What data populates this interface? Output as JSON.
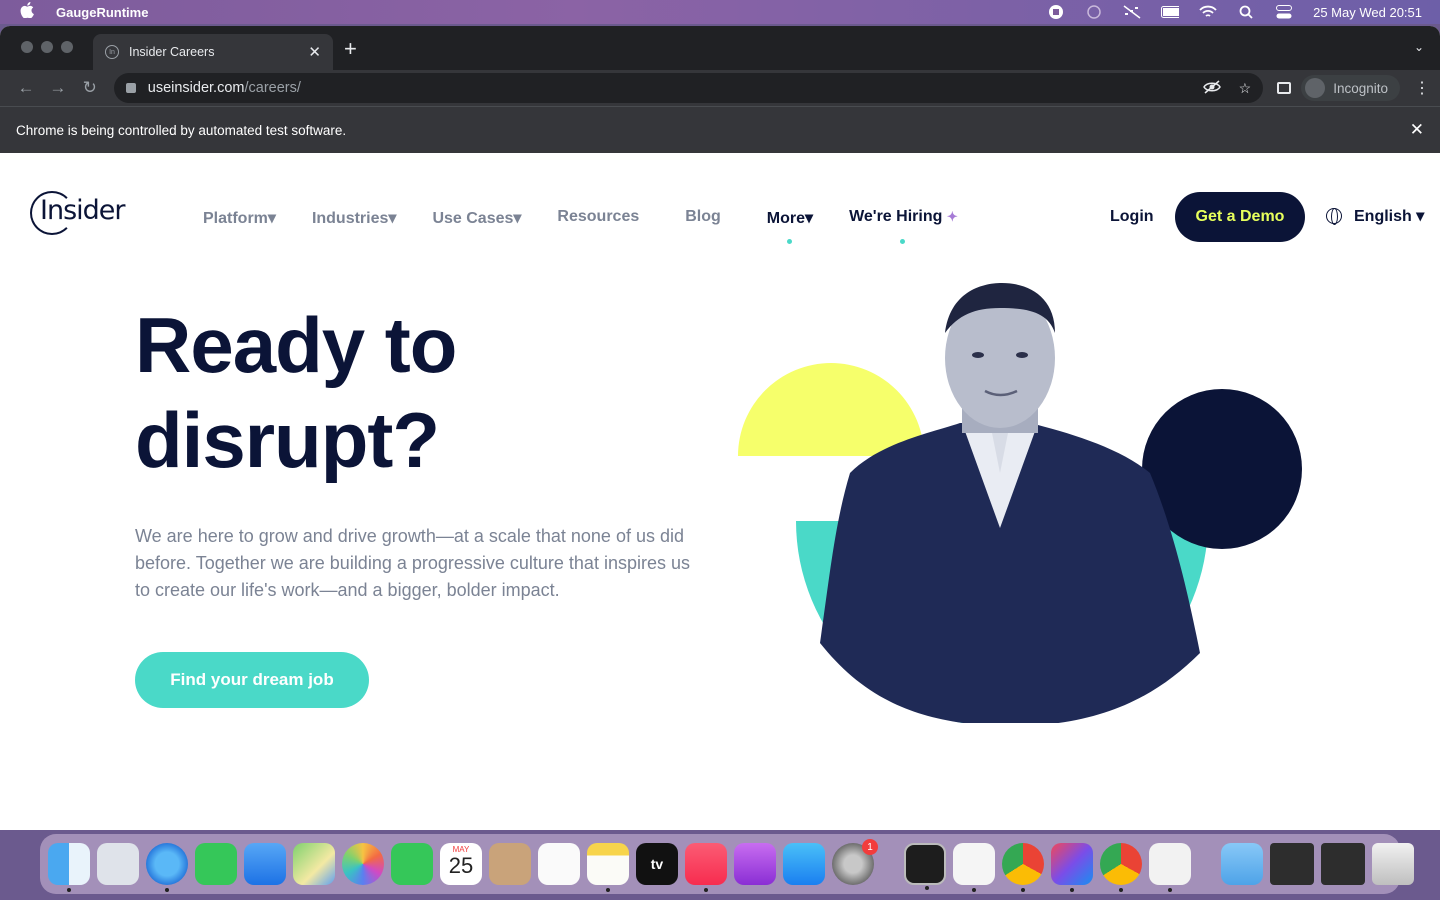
{
  "menubar": {
    "app_name": "GaugeRuntime",
    "datetime": "25 May Wed  20:51"
  },
  "browser": {
    "tab_title": "Insider Careers",
    "url_host": "useinsider.com",
    "url_path": "/careers/",
    "incognito_label": "Incognito",
    "infobar_text": "Chrome is being controlled by automated test software."
  },
  "site": {
    "logo_text": "Insider",
    "nav": [
      {
        "label": "Platform▾"
      },
      {
        "label": "Industries▾"
      },
      {
        "label": "Use Cases▾"
      },
      {
        "label": "Resources"
      },
      {
        "label": "Blog"
      },
      {
        "label": "More▾"
      },
      {
        "label": "We're Hiring"
      }
    ],
    "login": "Login",
    "demo_button": "Get a Demo",
    "language": "English ▾",
    "hero_title": "Ready to disrupt?",
    "hero_description": "We are here to grow and drive growth—at a scale that none of us did before. Together we are building a progressive culture that inspires us to create our life's work—and a bigger, bolder impact.",
    "cta": "Find your dream job"
  },
  "dock": {
    "calendar_month": "MAY",
    "calendar_day": "25",
    "settings_badge": "1",
    "tv_label": "tv"
  },
  "colors": {
    "navy": "#0b1437",
    "teal": "#4ad9c8",
    "yellow": "#f6ff6b",
    "demo_text": "#e7ff5c"
  }
}
